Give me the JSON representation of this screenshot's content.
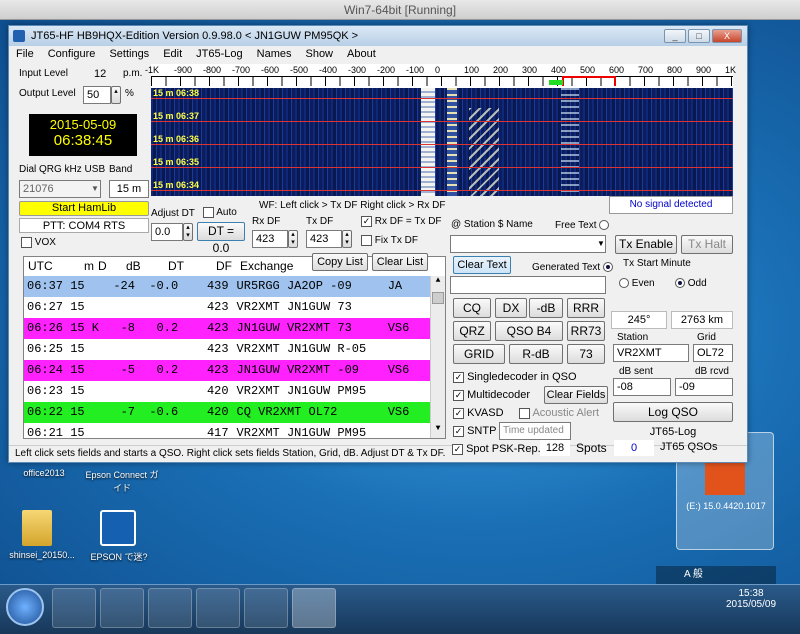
{
  "vm_title": "Win7-64bit [Running]",
  "window": {
    "title": "JT65-HF HB9HQX-Edition Version 0.9.98.0  < JN1GUW PM95QK >",
    "min": "_",
    "max": "□",
    "close": "X"
  },
  "menu": [
    "File",
    "Configure",
    "Settings",
    "Edit",
    "JT65-Log",
    "Names",
    "Show",
    "About"
  ],
  "input_level": {
    "label": "Input Level",
    "value": "12",
    "unit": "p.m."
  },
  "output_level": {
    "label": "Output Level",
    "value": "50",
    "unit": "%"
  },
  "clock": {
    "date": "2015-05-09",
    "time": "06:38:45"
  },
  "dial": {
    "label": "Dial QRG kHz USB",
    "value": "21076",
    "band_label": "Band",
    "band": "15 m"
  },
  "start_hamlib": "Start HamLib",
  "ptt": "PTT: COM4 RTS",
  "vox": "VOX",
  "scale": [
    "-1K",
    "-900",
    "-800",
    "-700",
    "-600",
    "-500",
    "-400",
    "-300",
    "-200",
    "-100",
    "0",
    "100",
    "200",
    "300",
    "400",
    "500",
    "600",
    "700",
    "800",
    "900",
    "1K"
  ],
  "wf_times": [
    "15 m 06:38",
    "15 m 06:37",
    "15 m 06:36",
    "15 m 06:35",
    "15 m 06:34"
  ],
  "wf_hint": "WF: Left click > Tx DF  Right click > Rx DF",
  "no_signal": "No signal detected",
  "adjust_dt": {
    "label": "Adjust DT",
    "value": "0.0",
    "auto": "Auto",
    "reset": "DT = 0.0"
  },
  "rx_df": {
    "label": "Rx DF",
    "value": "423"
  },
  "tx_df": {
    "label": "Tx DF",
    "value": "423"
  },
  "rx_eq_tx": "Rx DF = Tx DF",
  "fix_tx": "Fix Tx DF",
  "table": {
    "headers": [
      "UTC",
      "m",
      "D",
      "dB",
      "DT",
      "DF",
      "Exchange"
    ],
    "copy_list": "Copy List",
    "clear_list": "Clear List",
    "rows": [
      {
        "utc": "06:37",
        "m": "15",
        "d": "",
        "db": "-24",
        "dt": "-0.0",
        "df": "439",
        "ex": "UR5RGG JA2OP -09",
        "cc": "JA",
        "bg": "#9fc3ee"
      },
      {
        "utc": "06:27",
        "m": "15",
        "d": "",
        "db": "",
        "dt": "",
        "df": "423",
        "ex": "VR2XMT JN1GUW 73",
        "cc": "",
        "bg": "#ffffff"
      },
      {
        "utc": "06:26",
        "m": "15",
        "d": "K",
        "db": "-8",
        "dt": "0.2",
        "df": "423",
        "ex": "JN1GUW VR2XMT 73",
        "cc": "VS6",
        "bg": "#ff22ff"
      },
      {
        "utc": "06:25",
        "m": "15",
        "d": "",
        "db": "",
        "dt": "",
        "df": "423",
        "ex": "VR2XMT JN1GUW R-05",
        "cc": "",
        "bg": "#ffffff"
      },
      {
        "utc": "06:24",
        "m": "15",
        "d": "",
        "db": "-5",
        "dt": "0.2",
        "df": "423",
        "ex": "JN1GUW VR2XMT -09",
        "cc": "VS6",
        "bg": "#ff22ff"
      },
      {
        "utc": "06:23",
        "m": "15",
        "d": "",
        "db": "",
        "dt": "",
        "df": "420",
        "ex": "VR2XMT JN1GUW PM95",
        "cc": "",
        "bg": "#ffffff"
      },
      {
        "utc": "06:22",
        "m": "15",
        "d": "",
        "db": "-7",
        "dt": "-0.6",
        "df": "420",
        "ex": "CQ VR2XMT OL72",
        "cc": "VS6",
        "bg": "#22ee22"
      },
      {
        "utc": "06:21",
        "m": "15",
        "d": "",
        "db": "",
        "dt": "",
        "df": "417",
        "ex": "VR2XMT JN1GUW PM95",
        "cc": "",
        "bg": "#ffffff"
      }
    ]
  },
  "station_name": "@ Station  $ Name",
  "free_text": "Free Text",
  "clear_text": "Clear Text",
  "generated_text": "Generated Text",
  "tx_enable": "Tx Enable",
  "tx_halt": "Tx Halt",
  "tx_start_minute": "Tx Start Minute",
  "even": "Even",
  "odd": "Odd",
  "macros": [
    "CQ",
    "DX",
    "-dB",
    "RRR",
    "QRZ",
    "QSO B4",
    "RR73",
    "GRID",
    "R-dB",
    "73"
  ],
  "azimuth": "245°",
  "distance": "2763 km",
  "station": {
    "label": "Station",
    "value": "VR2XMT"
  },
  "grid": {
    "label": "Grid",
    "value": "OL72"
  },
  "db_sent": {
    "label": "dB sent",
    "value": "-08"
  },
  "db_rcvd": {
    "label": "dB rcvd",
    "value": "-09"
  },
  "log_qso": "Log QSO",
  "jt65_log": "JT65-Log",
  "qso_count": "0",
  "qso_label": "JT65 QSOs",
  "singledecoder": "Singledecoder in QSO",
  "multidecoder": "Multidecoder",
  "clear_fields": "Clear Fields",
  "kvasd": "KVASD",
  "acoustic": "Acoustic Alert",
  "sntp": "SNTP",
  "time_updated": "Time updated",
  "spot": "Spot PSK-Rep.",
  "spots_count": "128",
  "spots_label": "Spots",
  "status": "Left click sets fields and starts a QSO. Right click sets fields Station, Grid, dB. Adjust DT & Tx DF.",
  "desktop_icons": [
    "office2013",
    "Epson Connect ガイド",
    "shinsei_20150...",
    "EPSON で迷?"
  ],
  "office_panel": "(E:) 15.0.4420.1017",
  "tray": {
    "time": "15:38",
    "date": "2015/05/09",
    "ime": "A 般"
  }
}
